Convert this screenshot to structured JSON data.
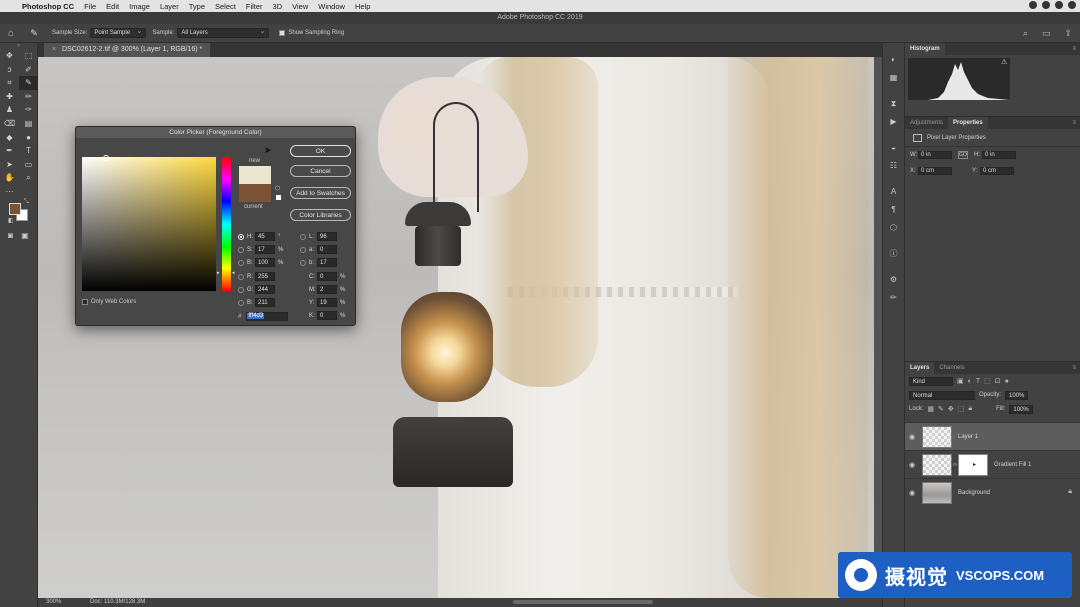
{
  "menubar": {
    "app": "Photoshop CC",
    "items": [
      "File",
      "Edit",
      "Image",
      "Layer",
      "Type",
      "Select",
      "Filter",
      "3D",
      "View",
      "Window",
      "Help"
    ]
  },
  "window_title": "Adobe Photoshop CC 2019",
  "options": {
    "sample_size_label": "Sample Size:",
    "sample_size_value": "Point Sample",
    "sample_label": "Sample:",
    "sample_value": "All Layers",
    "show_ring_label": "Show Sampling Ring",
    "show_ring_checked": true
  },
  "document_tab": {
    "close": "×",
    "title": "DSC02612-2.tif @ 300% (Layer 1, RGB/16) *"
  },
  "color_picker": {
    "title": "Color Picker (Foreground Color)",
    "new_label": "new",
    "current_label": "current",
    "new_color": "#ece6d1",
    "current_color": "#7a5434",
    "buttons": {
      "ok": "OK",
      "cancel": "Cancel",
      "add_swatches": "Add to Swatches",
      "color_libraries": "Color Libraries"
    },
    "only_web_colors": "Only Web Colors",
    "hsb": {
      "h": "45",
      "h_unit": "°",
      "s": "17",
      "s_unit": "%",
      "b": "100",
      "b_unit": "%"
    },
    "rgb": {
      "r": "255",
      "g": "244",
      "b": "211"
    },
    "lab": {
      "l": "96",
      "a": "0",
      "b": "17"
    },
    "cmyk": {
      "c": "0",
      "m": "2",
      "y": "19",
      "k": "0",
      "unit": "%"
    },
    "hex_label": "#",
    "hex_value": "fff4d3"
  },
  "panels": {
    "histogram_tab": "Histogram",
    "adjustments_tab": "Adjustments",
    "properties_tab": "Properties",
    "pixel_layer_props": "Pixel Layer Properties",
    "w_label": "W:",
    "w_value": "0 in",
    "h_label": "H:",
    "h_value": "0 in",
    "link_label": "GO",
    "x_label": "X:",
    "x_value": "0 cm",
    "y_label": "Y:",
    "y_value": "0 cm"
  },
  "layers_panel": {
    "tab_layers": "Layers",
    "tab_channels": "Channels",
    "kind": "Kind",
    "blend_mode": "Normal",
    "opacity_label": "Opacity:",
    "opacity_value": "100%",
    "lock_label": "Lock:",
    "fill_label": "Fill:",
    "fill_value": "100%",
    "layers": [
      {
        "name": "Layer 1",
        "selected": true
      },
      {
        "name": "Gradient Fill 1",
        "selected": false
      },
      {
        "name": "Background",
        "selected": false,
        "locked": true
      }
    ]
  },
  "status": {
    "zoom": "300%",
    "doc": "Doc: 110.3M/128.3M"
  },
  "watermark": {
    "cn": "摄视觉",
    "en": "VSCOPS.COM"
  }
}
